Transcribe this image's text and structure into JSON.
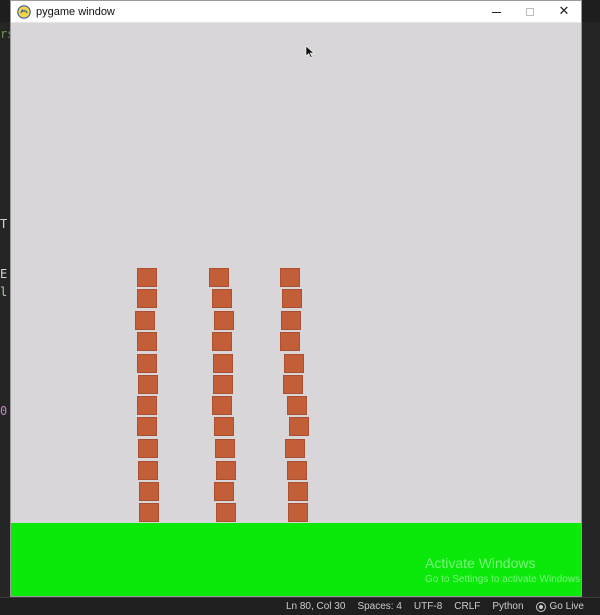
{
  "window": {
    "title": "pygame window",
    "app_icon": "pygame-snake-icon",
    "controls": {
      "minimize_icon": "minimize-icon",
      "maximize_icon": "maximize-icon",
      "close_icon": "close-icon"
    }
  },
  "canvas": {
    "background_color": "#d8d6d8",
    "ground_color": "#0be90b",
    "brick_color": "#c35f38",
    "stacks": [
      {
        "name": "stack-1",
        "brick_count": 12
      },
      {
        "name": "stack-2",
        "brick_count": 12
      },
      {
        "name": "stack-3",
        "brick_count": 12
      }
    ]
  },
  "watermark": {
    "title": "Activate Windows",
    "subtitle": "Go to Settings to activate Windows."
  },
  "statusbar": {
    "position": "Ln 80, Col 30",
    "spaces": "Spaces: 4",
    "encoding": "UTF-8",
    "eol": "CRLF",
    "language": "Python",
    "go_live": "Go Live",
    "go_live_icon": "broadcast-icon"
  },
  "background_fragments": {
    "left_1": "rs",
    "left_2": "T:",
    "left_3": "E",
    "left_4": "l",
    "left_5": "0"
  }
}
